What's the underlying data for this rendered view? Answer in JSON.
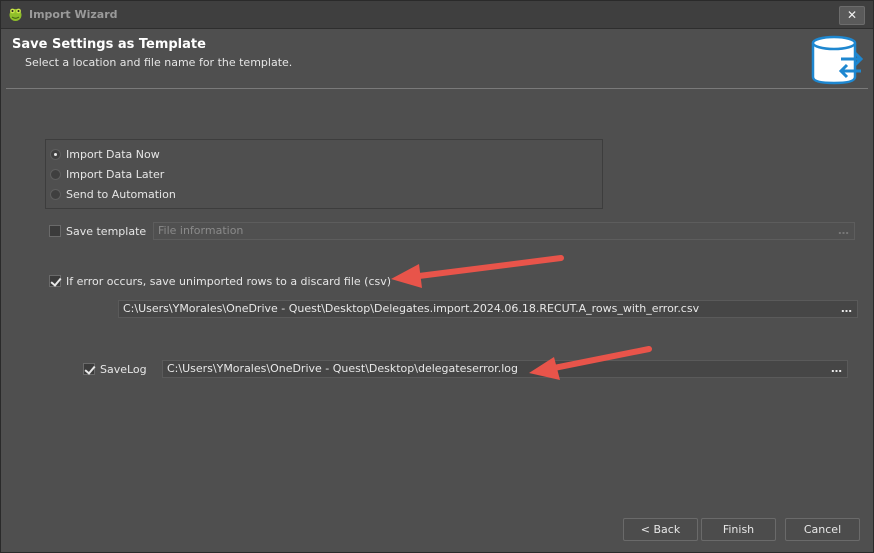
{
  "window": {
    "title": "Import Wizard"
  },
  "header": {
    "title": "Save Settings as Template",
    "subtitle": "Select a location and file name for the template."
  },
  "options": {
    "radios": [
      {
        "label": "Import Data Now",
        "checked": true
      },
      {
        "label": "Import Data Later",
        "checked": false
      },
      {
        "label": "Send to Automation",
        "checked": false
      }
    ]
  },
  "save_template": {
    "label": "Save template",
    "checked": false,
    "placeholder": "File information"
  },
  "discard": {
    "label": "If error occurs, save unimported rows to a discard file (csv)",
    "checked": true,
    "path": "C:\\Users\\YMorales\\OneDrive - Quest\\Desktop\\Delegates.import.2024.06.18.RECUT.A_rows_with_error.csv"
  },
  "savelog": {
    "label": "SaveLog",
    "checked": true,
    "path": "C:\\Users\\YMorales\\OneDrive - Quest\\Desktop\\delegateserror.log"
  },
  "browse_glyph": "…",
  "footer": {
    "back": "< Back",
    "finish": "Finish",
    "cancel": "Cancel"
  },
  "icons": {
    "app": "frog-app-icon",
    "header": "database-sync-icon",
    "close": "close-icon"
  },
  "colors": {
    "arrow": "#e8544a",
    "db_blue": "#1e87d0"
  }
}
